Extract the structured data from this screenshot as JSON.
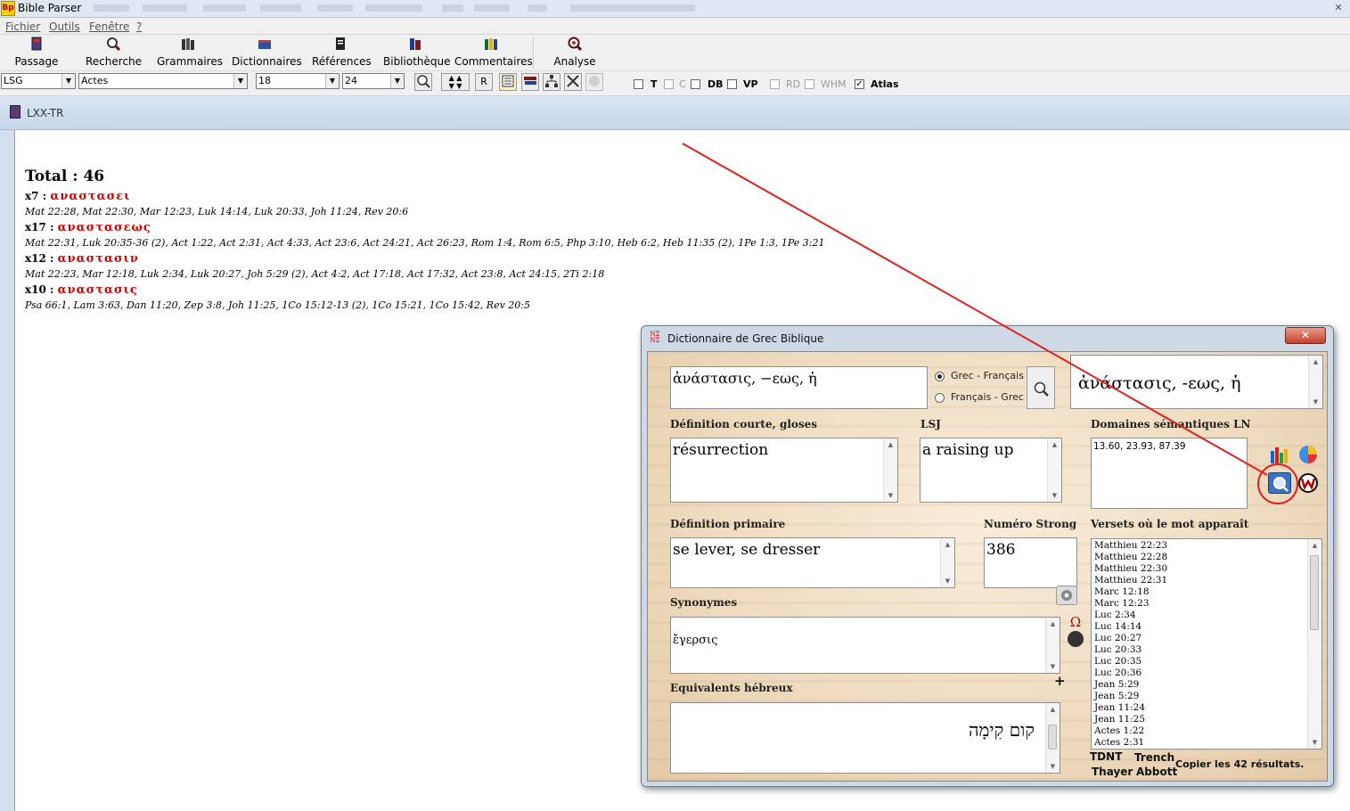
{
  "app": {
    "title": "Bible Parser",
    "icon_text": "Bp"
  },
  "menu": [
    "Fichier",
    "Outils",
    "Fenêtre",
    "?"
  ],
  "toolbar": [
    {
      "label": "Passage",
      "icon": "passage-icon"
    },
    {
      "label": "Recherche",
      "icon": "search-icon"
    },
    {
      "label": "Grammaires",
      "icon": "grammar-icon"
    },
    {
      "label": "Dictionnaires",
      "icon": "dictionary-icon"
    },
    {
      "label": "Références",
      "icon": "references-icon"
    },
    {
      "label": "Bibliothèque",
      "icon": "library-icon"
    },
    {
      "label": "Commentaires",
      "icon": "commentary-icon"
    },
    {
      "label": "Analyse",
      "icon": "analysis-icon"
    }
  ],
  "row2": {
    "version": "LSG",
    "book": "Actes",
    "size1": "18",
    "size2": "24",
    "r_button": "R",
    "checks": [
      {
        "label": "T",
        "checked": false,
        "enabled": true
      },
      {
        "label": "C",
        "checked": false,
        "enabled": false
      },
      {
        "label": "DB",
        "checked": false,
        "enabled": true
      },
      {
        "label": "VP",
        "checked": false,
        "enabled": true
      },
      {
        "label": "RD",
        "checked": false,
        "enabled": false
      },
      {
        "label": "WHM",
        "checked": false,
        "enabled": false
      },
      {
        "label": "Atlas",
        "checked": true,
        "enabled": true
      }
    ]
  },
  "child_window": {
    "title": "LXX-TR"
  },
  "results": {
    "total": "Total : 46",
    "groups": [
      {
        "count": "x7",
        "word": "αναστασει",
        "refs": "Mat 22:28, Mat 22:30, Mar 12:23, Luk 14:14, Luk 20:33, Joh 11:24, Rev 20:6"
      },
      {
        "count": "x17",
        "word": "αναστασεως",
        "refs": "Mat 22:31, Luk 20:35-36 (2), Act 1:22, Act 2:31, Act 4:33, Act 23:6, Act 24:21, Act 26:23, Rom 1:4, Rom 6:5, Php 3:10, Heb 6:2, Heb 11:35 (2), 1Pe 1:3, 1Pe 3:21"
      },
      {
        "count": "x12",
        "word": "αναστασιν",
        "refs": "Mat 22:23, Mar 12:18, Luk 2:34, Luk 20:27, Joh 5:29 (2), Act 4:2, Act 17:18, Act 17:32, Act 23:8, Act 24:15, 2Ti 2:18"
      },
      {
        "count": "x10",
        "word": "αναστασις",
        "refs": "Psa 66:1, Lam 3:63, Dan 11:20, Zep 3:8, Joh 11:25, 1Co 15:12-13 (2), 1Co 15:21, 1Co 15:42, Rev 20:5"
      }
    ]
  },
  "dialog": {
    "title": "Dictionnaire de Grec Biblique",
    "close": "✕",
    "search_value": "ἀνάστασις, −εως, ἡ",
    "radio_grec_fr": "Grec - Français",
    "radio_fr_grec": "Français - Grec",
    "headword": "ἀνάστασις, -εως, ἡ",
    "label_short": "Définition courte, gloses",
    "value_short": "résurrection",
    "label_lsj": "LSJ",
    "value_lsj": "a raising up",
    "label_domains": "Domaines sémantiques LN",
    "value_domains": "13.60,  23.93,  87.39",
    "label_primary": "Définition primaire",
    "value_primary": "se lever, se dresser",
    "label_strong": "Numéro Strong",
    "value_strong": "386",
    "label_synonyms": "Synonymes",
    "value_synonyms": "ἔγερσις",
    "label_hebrew": "Equivalents hébreux",
    "value_hebrew": "קום קִימָה",
    "plus": "+",
    "label_verses": "Versets où le mot apparaît",
    "verses": [
      "Matthieu 22:23",
      "Matthieu 22:28",
      "Matthieu 22:30",
      "Matthieu 22:31",
      "Marc 12:18",
      "Marc 12:23",
      "Luc 2:34",
      "Luc 14:14",
      "Luc 20:27",
      "Luc 20:33",
      "Luc 20:35",
      "Luc 20:36",
      "Jean 5:29",
      "Jean 5:29",
      "Jean 11:24",
      "Jean 11:25",
      "Actes 1:22",
      "Actes 2:31"
    ],
    "tdnt": "TDNT",
    "trench": "Trench",
    "thayer": "Thayer",
    "abbott": "Abbott",
    "copy": "Copier les 42 résultats."
  },
  "colors": {
    "accent_red": "#d40000",
    "annotation": "#e02020"
  }
}
